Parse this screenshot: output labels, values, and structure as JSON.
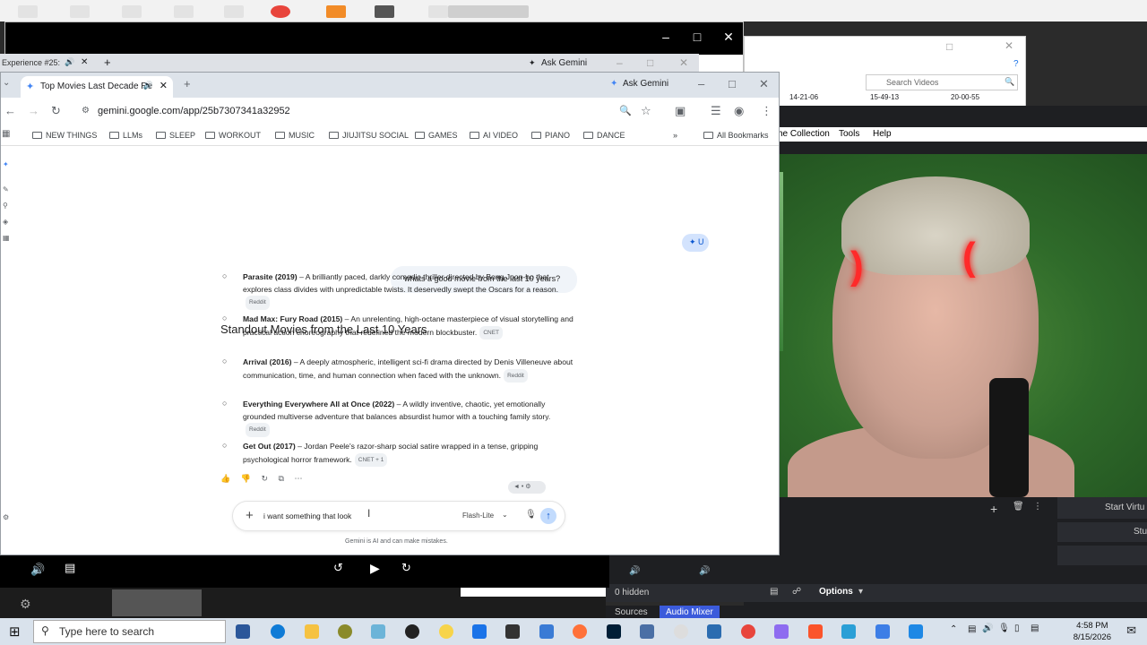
{
  "back_window": {
    "tab_fragment": "Experience #25:",
    "ask_gemini": "Ask Gemini",
    "obs_menu": [
      "he Collection",
      "Tools",
      "Help"
    ]
  },
  "right_window": {
    "search_placeholder": "Search Videos",
    "times": [
      "14-21-06",
      "15-49-13",
      "20-00-55"
    ]
  },
  "chrome": {
    "tab_title": "Top Movies Last Decade Re",
    "ask_gemini": "Ask Gemini",
    "url": "gemini.google.com/app/25b7307341a32952",
    "bookmarks": [
      "NEW THINGS",
      "LLMs",
      "SLEEP",
      "WORKOUT",
      "MUSIC",
      "JIUJITSU SOCIAL",
      "GAMES",
      "AI VIDEO",
      "PIANO",
      "DANCE"
    ],
    "all_bookmarks": "All Bookmarks"
  },
  "chat": {
    "user_message": "whats a good movie from the last 10 years?",
    "response_title": "Standout Movies from the Last 10 Years",
    "items": [
      {
        "title": "Parasite (2019)",
        "text": " – A brilliantly paced, darkly comedic thriller directed by Bong Joon-ho that explores class divides with unpredictable twists. It deservedly swept the Oscars for a reason.",
        "source": "Reddit"
      },
      {
        "title": "Mad Max: Fury Road (2015)",
        "text": " – An unrelenting, high-octane masterpiece of visual storytelling and practical action choreography that redefined the modern blockbuster.",
        "source": "CNET"
      },
      {
        "title": "Arrival (2016)",
        "text": " – A deeply atmospheric, intelligent sci-fi drama directed by Denis Villeneuve about communication, time, and human connection when faced with the unknown.",
        "source": "Reddit"
      },
      {
        "title": "Everything Everywhere All at Once (2022)",
        "text": " – A wildly inventive, chaotic, yet emotionally grounded multiverse adventure that balances absurdist humor with a touching family story.",
        "source": "Reddit"
      },
      {
        "title": "Get Out (2017)",
        "text": " – Jordan Peele's razor-sharp social satire wrapped in a tense, gripping psychological horror framework.",
        "source": "CNET + 1"
      }
    ],
    "input_text": "i want something that look",
    "model": "Flash-Lite",
    "disclaimer": "Gemini is AI and can make mistakes."
  },
  "obs": {
    "start_virtual": "Start Virtu",
    "studio": "Stu",
    "hidden": "0 hidden",
    "options": "Options",
    "tabs": [
      "Sources",
      "Audio Mixer"
    ]
  },
  "taskbar": {
    "search_placeholder": "Type here to search",
    "time": "4:58 PM",
    "date": "8/15/2026"
  },
  "colors": {
    "accent": "#0b57d0",
    "obs_bg": "#1e1f22",
    "taskbar": "#d9e2ec"
  }
}
